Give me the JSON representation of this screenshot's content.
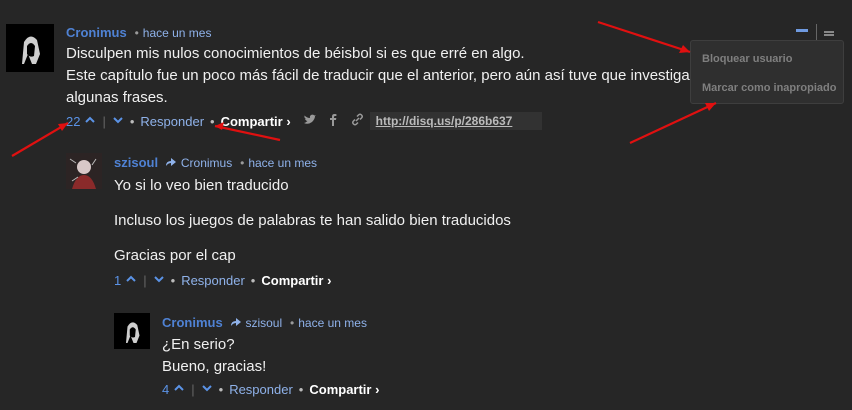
{
  "comment1": {
    "author": "Cronimus",
    "time": "hace un mes",
    "lines": [
      "Disculpen mis nulos conocimientos de béisbol si es que erré en algo.",
      "Este capítulo fue un poco más fácil de traducir que el anterior, pero aún así tuve que investigar",
      "algunas frases."
    ],
    "votes": "22",
    "reply_label": "Responder",
    "share_label": "Compartir ›",
    "link": "http://disq.us/p/286b637"
  },
  "menu": {
    "items": [
      "Bloquear usuario",
      "Marcar como inapropiado"
    ]
  },
  "comment2": {
    "author": "szisoul",
    "reply_to": "Cronimus",
    "time": "hace un mes",
    "paragraphs": [
      "Yo si lo veo bien traducido",
      "Incluso los juegos de palabras te han salido bien traducidos",
      "Gracias por el cap"
    ],
    "votes": "1",
    "reply_label": "Responder",
    "share_label": "Compartir ›"
  },
  "comment3": {
    "author": "Cronimus",
    "reply_to": "szisoul",
    "time": "hace un mes",
    "lines": [
      "¿En serio?",
      "Bueno, gracias!"
    ],
    "votes": "4",
    "reply_label": "Responder",
    "share_label": "Compartir ›"
  },
  "colors": {
    "background": "#262626",
    "author": "#4f82d4",
    "link": "#8fb2ea",
    "annotation_arrow": "#e01010"
  }
}
